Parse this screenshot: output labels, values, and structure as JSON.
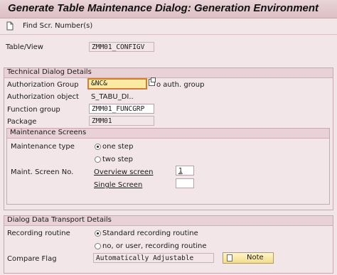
{
  "window": {
    "title": "Generate Table Maintenance Dialog: Generation Environment"
  },
  "toolbar": {
    "find_label": "Find Scr. Number(s)",
    "icon": "document-icon"
  },
  "table_view": {
    "label": "Table/View",
    "value": "ZMM01_CONFIGV"
  },
  "technical": {
    "header": "Technical Dialog Details",
    "auth_group_label": "Authorization Group",
    "auth_group_value": "&NC&",
    "auth_group_hint": "o auth. group",
    "auth_object_label": "Authorization object",
    "auth_object_value": "S_TABU_DI..",
    "function_group_label": "Function group",
    "function_group_value": "ZMM01_FUNCGRP",
    "package_label": "Package",
    "package_value": "ZMM01"
  },
  "screens": {
    "header": "Maintenance Screens",
    "type_label": "Maintenance type",
    "one_step": "one step",
    "two_step": "two step",
    "selected": "one step",
    "screen_no_label": "Maint. Screen No.",
    "overview_label": "Overview screen",
    "overview_value": "1",
    "single_label": "Single Screen",
    "single_value": ""
  },
  "transport": {
    "header": "Dialog Data Transport Details",
    "recording_label": "Recording routine",
    "standard": "Standard recording routine",
    "user_routine": "no, or user, recording routine",
    "selected": "Standard recording routine",
    "compare_label": "Compare Flag",
    "compare_value": "Automatically Adjustable",
    "note_label": "Note"
  }
}
